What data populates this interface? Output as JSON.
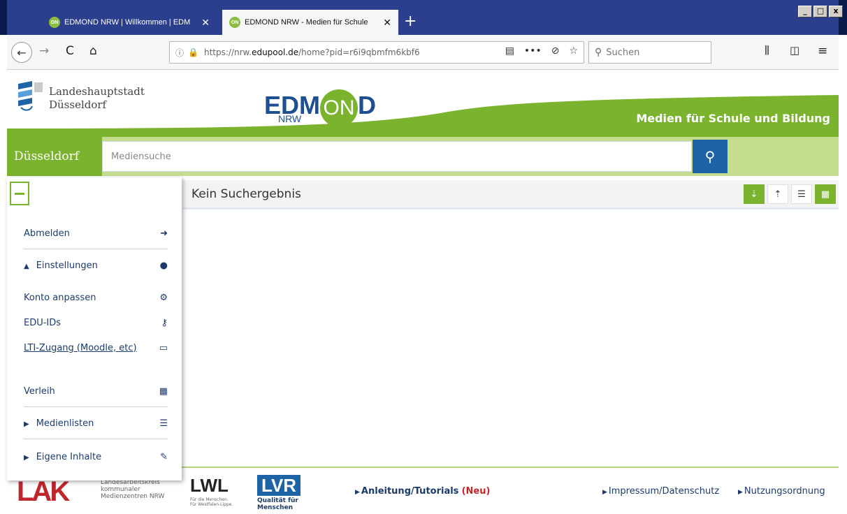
{
  "browser": {
    "tabs": [
      {
        "title": "EDMOND NRW | Willkommen | EDM",
        "favicon": "ON"
      },
      {
        "title": "EDMOND NRW - Medien für Schule",
        "favicon": "ON"
      }
    ],
    "url_prefix": "https://nrw.",
    "url_domain": "edupool.de",
    "url_path": "/home?pid=r6i9qbmfm6kbf6",
    "search_placeholder": "Suchen",
    "window_controls": [
      "_",
      "□",
      "x"
    ]
  },
  "header": {
    "city_line1": "Landeshauptstadt",
    "city_line2": "Düsseldorf",
    "logo_edm": "EDM",
    "logo_on": "ON",
    "logo_d": "D",
    "logo_nrw": "NRW",
    "tagline": "Medien für Schule und Bildung",
    "accent_color": "#7bb32e",
    "brand_blue": "#1d63a6"
  },
  "search": {
    "city_button": "Düsseldorf",
    "placeholder": "Mediensuche"
  },
  "results": {
    "title": "Kein Suchergebnis"
  },
  "sidemenu": {
    "items": [
      {
        "label": "Abmelden",
        "icon": "sign-in-icon"
      },
      {
        "label": "Einstellungen",
        "icon": "user-icon"
      },
      {
        "label": "Konto anpassen",
        "icon": "gear-icon"
      },
      {
        "label": "EDU-IDs",
        "icon": "key-icon"
      },
      {
        "label": "LTI-Zugang (Moodle, etc)",
        "icon": "monitor-icon"
      },
      {
        "label": "Verleih",
        "icon": "calendar-icon"
      },
      {
        "label": "Medienlisten",
        "icon": "list-icon"
      },
      {
        "label": "Eigene Inhalte",
        "icon": "edit-icon"
      }
    ]
  },
  "footer": {
    "lak": "LAK",
    "lak_line1": "Landesarbeitskreis",
    "lak_line2": "kommunaler",
    "lak_line3": "Medienzentren NRW",
    "lwl": "LWL",
    "lwl_line1": "Für die Menschen.",
    "lwl_line2": "Für Westfalen-Lippe.",
    "lvr": "LVR",
    "lvr_sub": "Qualität für Menschen",
    "tutorials": "Anleitung/Tutorials",
    "tutorials_new": "(Neu)",
    "impressum": "Impressum/Datenschutz",
    "nutzung": "Nutzungsordnung"
  }
}
